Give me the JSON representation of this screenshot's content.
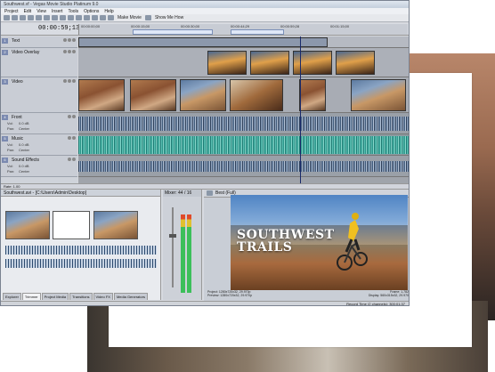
{
  "window": {
    "title": "Southwest.vf - Vegas Movie Studio Platinum 9.0"
  },
  "menu": [
    "Project",
    "Edit",
    "View",
    "Insert",
    "Tools",
    "Options",
    "Help"
  ],
  "toolbar": {
    "make_movie": "Make Movie",
    "show_me_how": "Show Me How"
  },
  "timecode": "00:00:59;13",
  "ruler": {
    "marks": [
      "00:00:00;00",
      "00:00:15;00",
      "00:00:30;00",
      "00:00:44;29",
      "00:00:59;28",
      "00:01:15;00"
    ]
  },
  "tracks": [
    {
      "num": "1",
      "name": "Text"
    },
    {
      "num": "2",
      "name": "Video Overlay"
    },
    {
      "num": "3",
      "name": "Video"
    },
    {
      "num": "4",
      "name": "Front",
      "vol": "0.0 dB",
      "pan": "Center"
    },
    {
      "num": "5",
      "name": "Music",
      "vol": "0.0 dB",
      "pan": "Center"
    },
    {
      "num": "6",
      "name": "Sound Effects",
      "vol": "0.0 dB",
      "pan": "Center"
    }
  ],
  "track_labels": {
    "vol": "Vol:",
    "pan": "Pan:"
  },
  "rate": "Rate: 1.00",
  "explorer": {
    "path": "Southwest.avi  - [C:\\Users\\Admin\\Desktop]",
    "tabs": [
      "Explorer",
      "Trimmer",
      "Project Media",
      "Transitions",
      "Video FX",
      "Media Generators"
    ],
    "active_tab": "Trimmer"
  },
  "mixer": {
    "title": "Mixer: 44 / 16"
  },
  "preview": {
    "quality": "Best (Full)",
    "title_line1": "SOUTHWEST",
    "title_line2": "TRAILS",
    "project_label": "Project:",
    "project": "1280x720x32, 29.970p",
    "preview_label": "Preview:",
    "preview_val": "1280x720x32, 29.970p",
    "frame_label": "Frame:",
    "frame": "1,782",
    "display_label": "Display:",
    "display": "560x315x32, 29.970"
  },
  "status": {
    "record_time": "Record Time (2 channels): 300:01:37"
  }
}
